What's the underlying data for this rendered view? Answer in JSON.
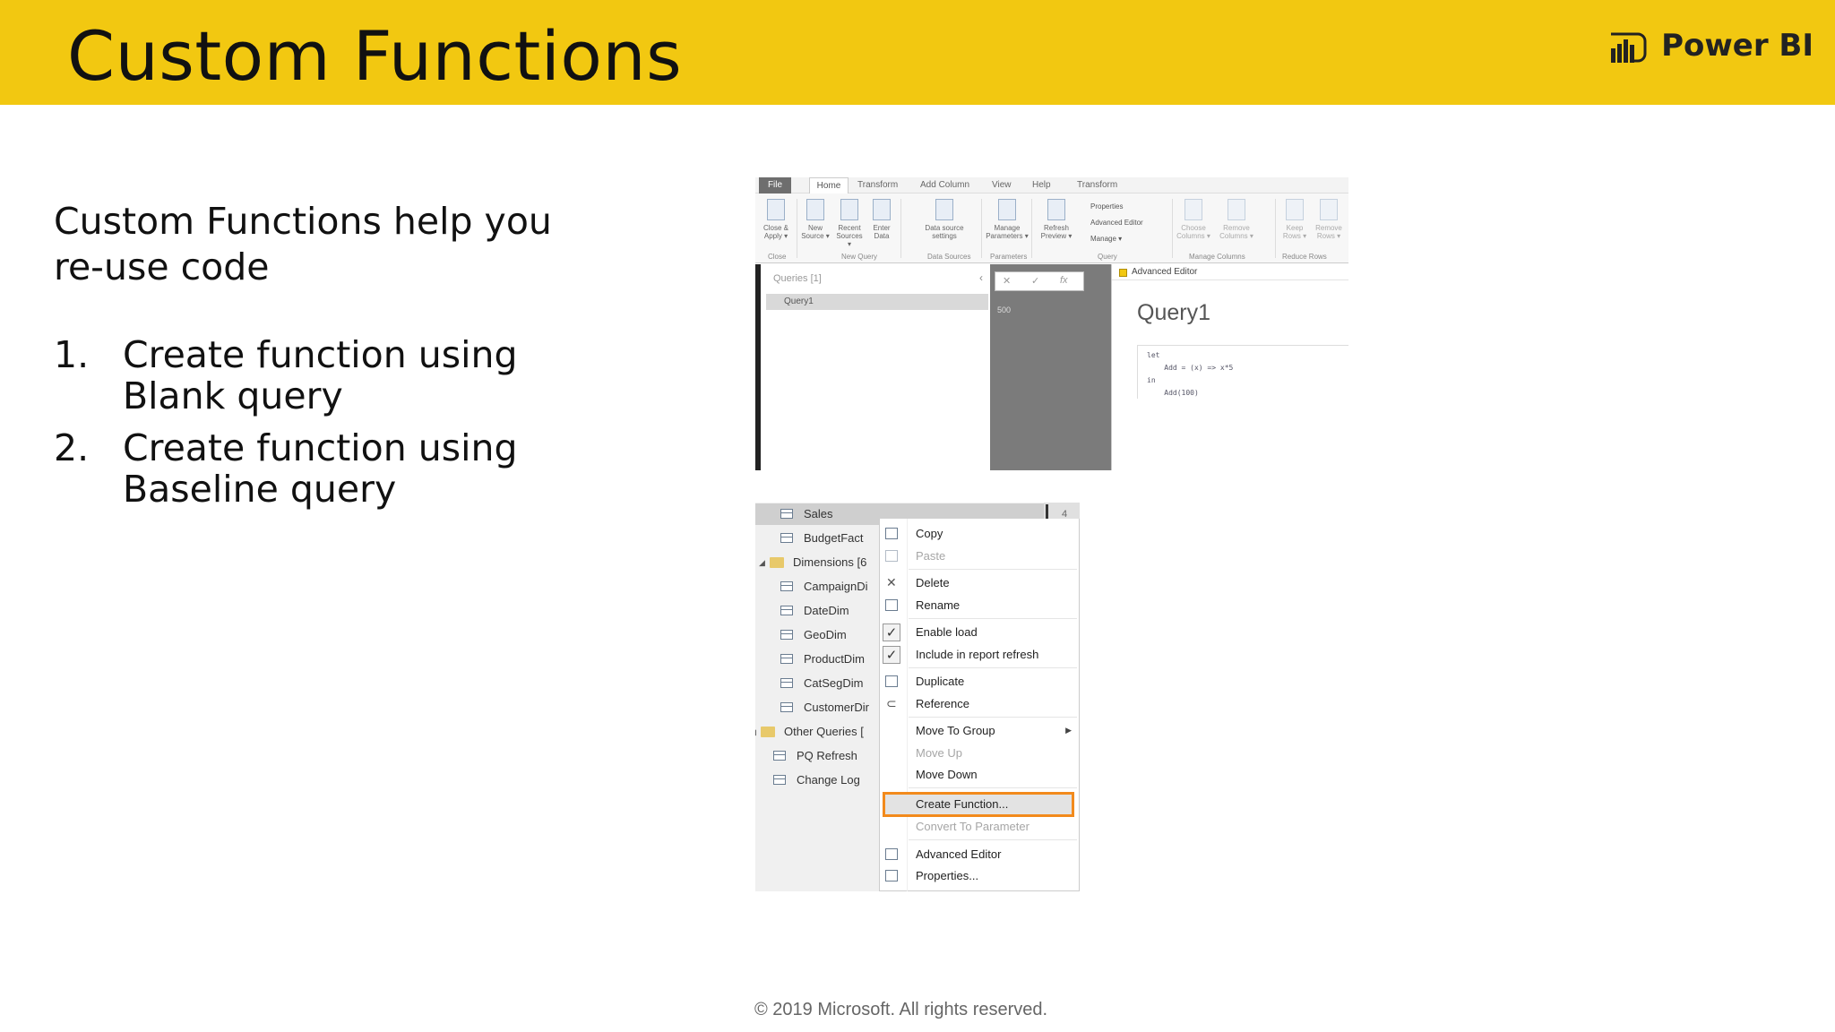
{
  "header": {
    "title": "Custom Functions",
    "brand": "Power BI",
    "color": "#f2c811"
  },
  "content": {
    "intro": "Custom Functions help you re-use code",
    "steps": [
      {
        "num": "1.",
        "text": "Create function using Blank query"
      },
      {
        "num": "2.",
        "text": "Create function using Baseline query"
      }
    ]
  },
  "footer": {
    "copyright": "© 2019 Microsoft. All rights reserved."
  },
  "editor_screenshot": {
    "tabs": [
      "File",
      "Home",
      "Transform",
      "Add Column",
      "View",
      "Help",
      "Transform"
    ],
    "ribbon_buttons": [
      {
        "label": "Close & Apply ▾"
      },
      {
        "label": "New Source ▾"
      },
      {
        "label": "Recent Sources ▾"
      },
      {
        "label": "Enter Data"
      },
      {
        "label": "Data source settings"
      },
      {
        "label": "Manage Parameters ▾"
      },
      {
        "label": "Refresh Preview ▾"
      },
      {
        "label": "Choose Columns ▾"
      },
      {
        "label": "Remove Columns ▾"
      },
      {
        "label": "Keep Rows ▾"
      },
      {
        "label": "Remove Rows ▾"
      }
    ],
    "small_buttons": [
      "Properties",
      "Advanced Editor",
      "Manage ▾"
    ],
    "groups": [
      "Close",
      "New Query",
      "Data Sources",
      "Parameters",
      "Query",
      "Manage Columns",
      "Reduce Rows"
    ],
    "queries_header": "Queries [1]",
    "query_item": "Query1",
    "formula_bar_icons": [
      "✕",
      "✓",
      "fx"
    ],
    "grid_value": "500",
    "advanced_editor": {
      "window_title": "Advanced Editor",
      "query_name": "Query1",
      "code": "let\n    Add = (x) => x*5\nin\n    Add(100)"
    }
  },
  "context_screenshot": {
    "count": "4",
    "tree": [
      {
        "label": "Sales",
        "kind": "table",
        "selected": true
      },
      {
        "label": "BudgetFact",
        "kind": "table"
      },
      {
        "label": "Dimensions [6",
        "kind": "folder"
      },
      {
        "label": "CampaignDi",
        "kind": "table"
      },
      {
        "label": "DateDim",
        "kind": "table"
      },
      {
        "label": "GeoDim",
        "kind": "table"
      },
      {
        "label": "ProductDim",
        "kind": "table"
      },
      {
        "label": "CatSegDim",
        "kind": "table"
      },
      {
        "label": "CustomerDir",
        "kind": "table"
      },
      {
        "label": "Other Queries [",
        "kind": "folder"
      },
      {
        "label": "PQ Refresh",
        "kind": "table"
      },
      {
        "label": "Change Log",
        "kind": "table"
      }
    ],
    "menu": {
      "copy": "Copy",
      "paste": "Paste",
      "delete": "Delete",
      "rename": "Rename",
      "enable_load": "Enable load",
      "include_refresh": "Include in report refresh",
      "duplicate": "Duplicate",
      "reference": "Reference",
      "move_to_group": "Move To Group",
      "move_up": "Move Up",
      "move_down": "Move Down",
      "create_function": "Create Function...",
      "convert_param": "Convert To Parameter",
      "advanced_editor": "Advanced Editor",
      "properties": "Properties..."
    },
    "highlight_color": "#f28a1c"
  }
}
